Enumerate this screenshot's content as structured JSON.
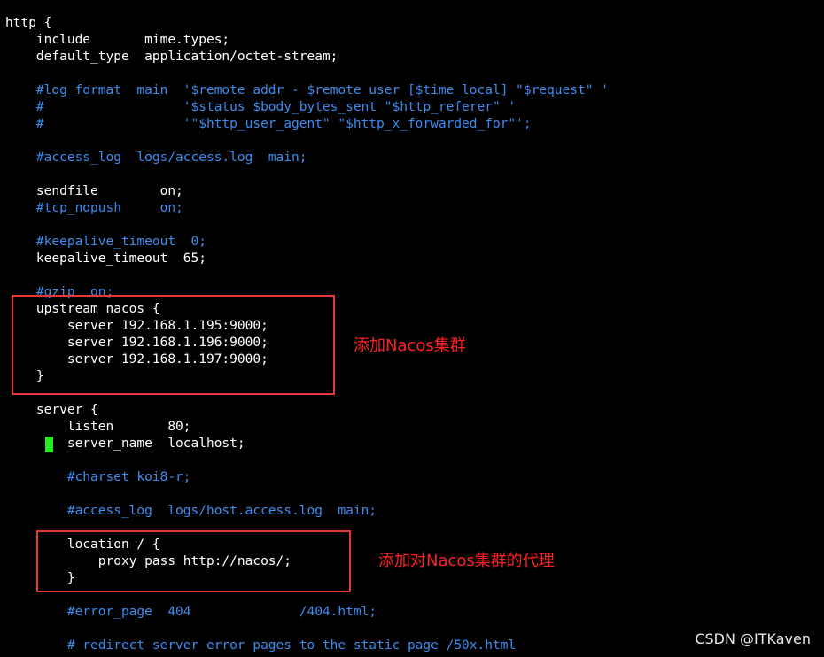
{
  "colors": {
    "background": "#000000",
    "code": "#ffffff",
    "comment": "#3b8cf0",
    "annotation": "#ff2020",
    "cursor": "#22ee22"
  },
  "lines": [
    {
      "text": "http {",
      "type": "code"
    },
    {
      "text": "    include       mime.types;",
      "type": "code"
    },
    {
      "text": "    default_type  application/octet-stream;",
      "type": "code"
    },
    {
      "text": "",
      "type": "code"
    },
    {
      "text": "    #log_format  main  '$remote_addr - $remote_user [$time_local] \"$request\" '",
      "type": "comment"
    },
    {
      "text": "    #                  '$status $body_bytes_sent \"$http_referer\" '",
      "type": "comment"
    },
    {
      "text": "    #                  '\"$http_user_agent\" \"$http_x_forwarded_for\"';",
      "type": "comment"
    },
    {
      "text": "",
      "type": "code"
    },
    {
      "text": "    #access_log  logs/access.log  main;",
      "type": "comment"
    },
    {
      "text": "",
      "type": "code"
    },
    {
      "text": "    sendfile        on;",
      "type": "code"
    },
    {
      "text": "    #tcp_nopush     on;",
      "type": "comment"
    },
    {
      "text": "",
      "type": "code"
    },
    {
      "text": "    #keepalive_timeout  0;",
      "type": "comment"
    },
    {
      "text": "    keepalive_timeout  65;",
      "type": "code"
    },
    {
      "text": "",
      "type": "code"
    },
    {
      "text": "    #gzip  on;",
      "type": "comment"
    },
    {
      "text": "    upstream nacos {",
      "type": "code"
    },
    {
      "text": "        server 192.168.1.195:9000;",
      "type": "code"
    },
    {
      "text": "        server 192.168.1.196:9000;",
      "type": "code"
    },
    {
      "text": "        server 192.168.1.197:9000;",
      "type": "code"
    },
    {
      "text": "    }",
      "type": "code"
    },
    {
      "text": "",
      "type": "code"
    },
    {
      "text": "    server {",
      "type": "code"
    },
    {
      "text": "        listen       80;",
      "type": "code"
    },
    {
      "text": "        server_name  localhost;",
      "type": "code"
    },
    {
      "text": "",
      "type": "code"
    },
    {
      "text": "        #charset koi8-r;",
      "type": "comment"
    },
    {
      "text": "",
      "type": "code"
    },
    {
      "text": "        #access_log  logs/host.access.log  main;",
      "type": "comment"
    },
    {
      "text": "",
      "type": "code"
    },
    {
      "text": "        location / {",
      "type": "code"
    },
    {
      "text": "            proxy_pass http://nacos/;",
      "type": "code"
    },
    {
      "text": "        }",
      "type": "code"
    },
    {
      "text": "",
      "type": "code"
    },
    {
      "text": "        #error_page  404              /404.html;",
      "type": "comment"
    },
    {
      "text": "",
      "type": "code"
    },
    {
      "text": "        # redirect server error pages to the static page /50x.html",
      "type": "comment"
    }
  ],
  "annotations": {
    "upstream_note": "添加Nacos集群",
    "proxy_note": "添加对Nacos集群的代理"
  },
  "watermark": "CSDN @ITKaven"
}
